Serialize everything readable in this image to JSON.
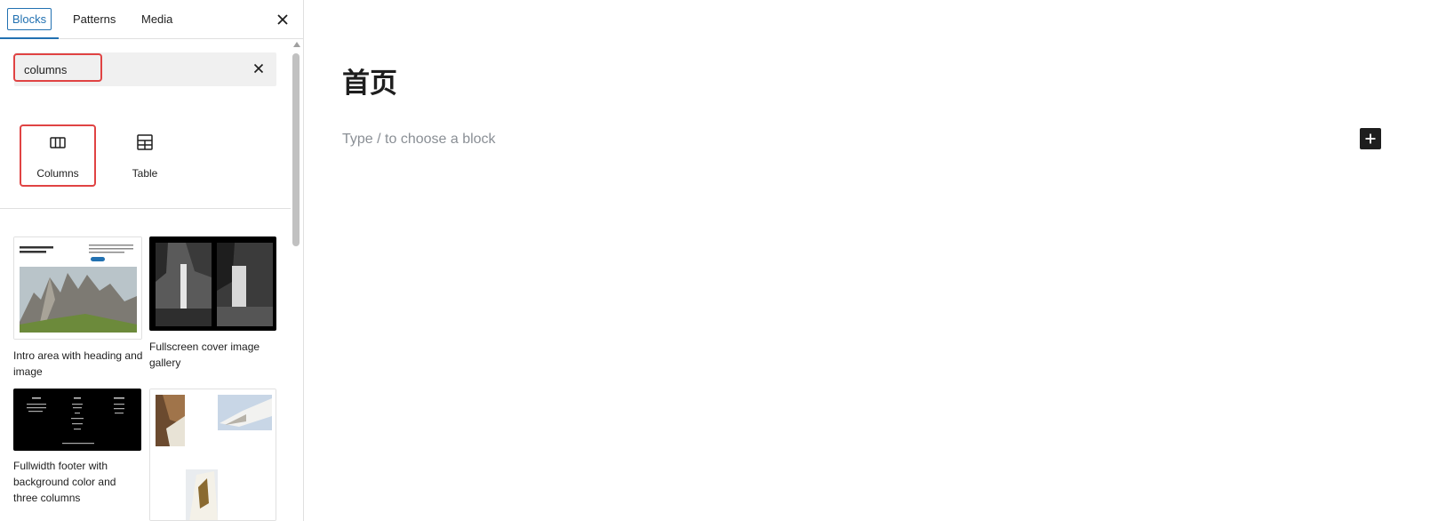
{
  "sidebar": {
    "tabs": [
      {
        "label": "Blocks",
        "active": true
      },
      {
        "label": "Patterns",
        "active": false
      },
      {
        "label": "Media",
        "active": false
      }
    ],
    "close_icon": "close-icon",
    "search": {
      "value": "columns",
      "placeholder": "Search",
      "clear_icon": "close-icon"
    },
    "blocks": [
      {
        "label": "Columns",
        "icon": "columns-icon"
      },
      {
        "label": "Table",
        "icon": "table-icon"
      }
    ],
    "patterns": [
      {
        "caption": "Intro area with heading and image"
      },
      {
        "caption": "Fullscreen cover image gallery"
      },
      {
        "caption": "Fullwidth footer with background color and three columns"
      },
      {
        "caption": ""
      }
    ]
  },
  "editor": {
    "page_title": "首页",
    "placeholder": "Type / to choose a block",
    "add_block_icon": "plus-icon"
  },
  "colors": {
    "accent": "#2271b1",
    "highlight": "#e04343",
    "dark": "#1e1e1e"
  }
}
